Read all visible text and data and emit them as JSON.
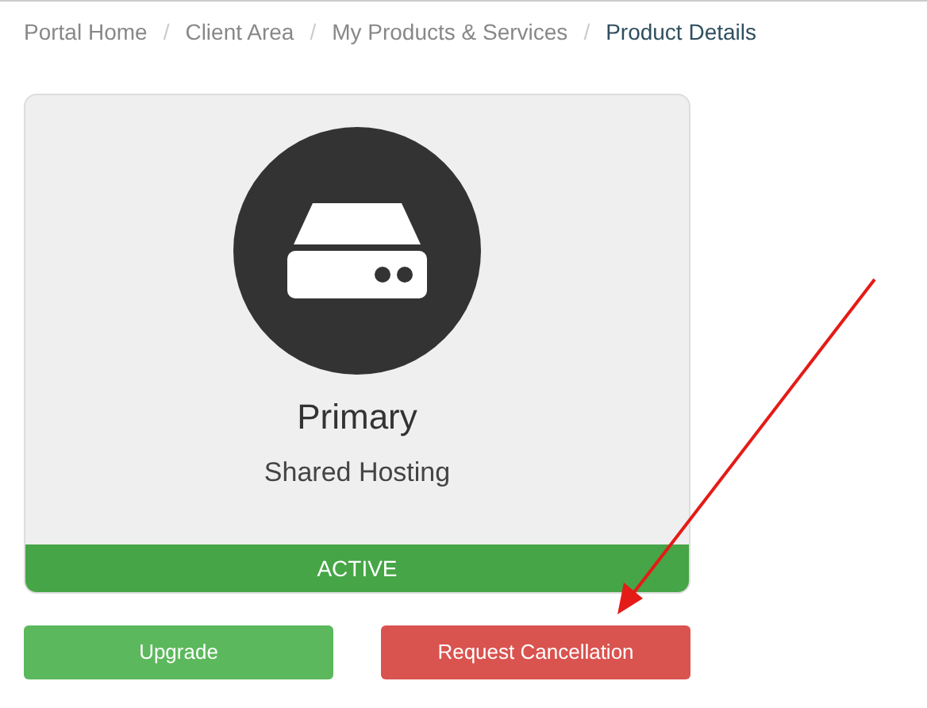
{
  "breadcrumb_separator": "/",
  "breadcrumb": [
    {
      "label": "Portal Home",
      "current": false
    },
    {
      "label": "Client Area",
      "current": false
    },
    {
      "label": "My Products & Services",
      "current": false
    },
    {
      "label": "Product Details",
      "current": true
    }
  ],
  "product": {
    "name": "Primary",
    "group": "Shared Hosting",
    "status": "ACTIVE"
  },
  "buttons": [
    {
      "label": "Upgrade",
      "kind": "success"
    },
    {
      "label": "Request Cancellation",
      "kind": "danger"
    }
  ]
}
